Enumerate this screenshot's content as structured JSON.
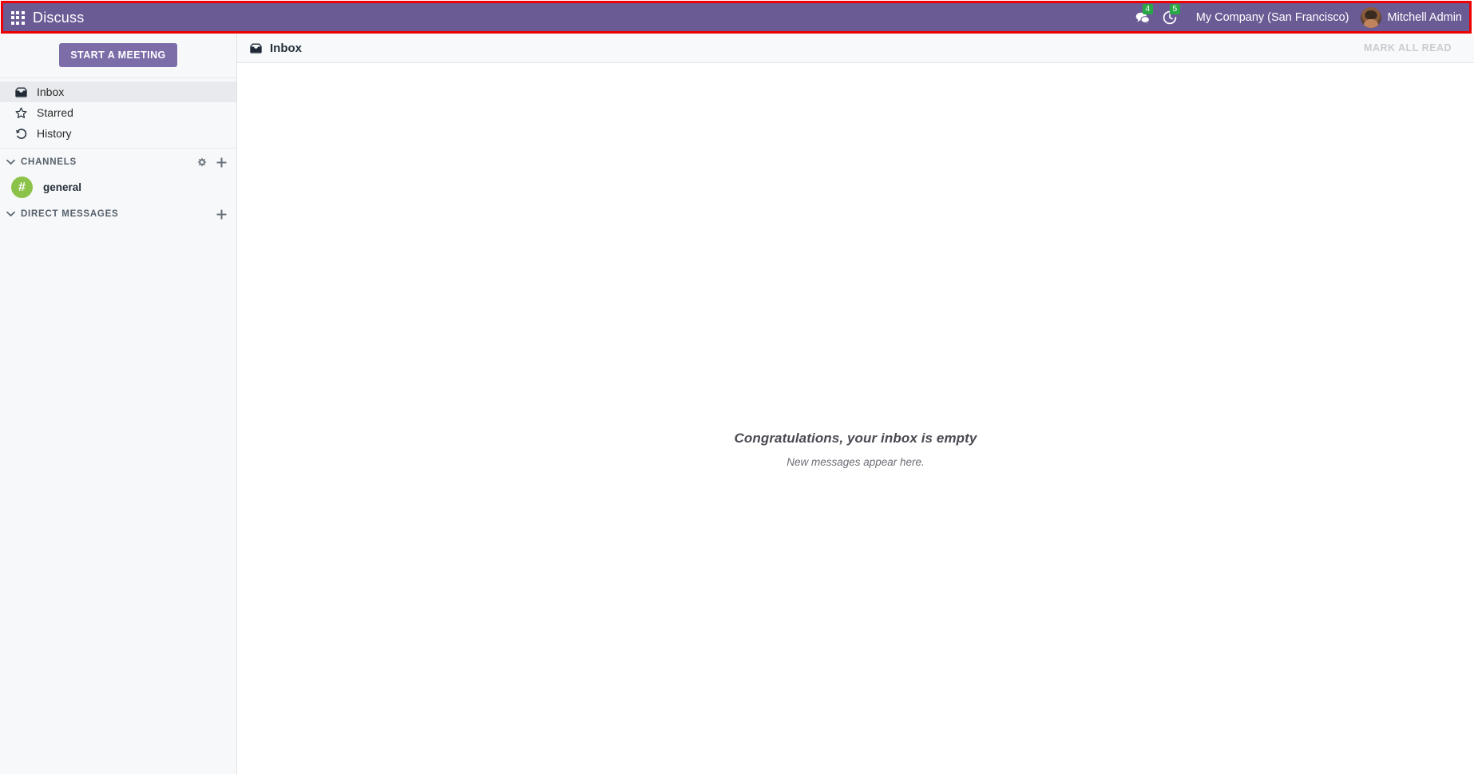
{
  "navbar": {
    "apps_icon": "apps-grid-icon",
    "brand": "Discuss",
    "messages": {
      "icon": "messages-bubble-icon",
      "badge": "4"
    },
    "activities": {
      "icon": "activity-clock-icon",
      "badge": "5"
    },
    "company": "My Company (San Francisco)",
    "user": "Mitchell Admin",
    "avatar_alt": "user-avatar",
    "background_color": "#6b5b95",
    "badge_color": "#28a745",
    "highlight_color": "#ee0000"
  },
  "sidebar": {
    "start_meeting_label": "START A MEETING",
    "mailboxes": [
      {
        "label": "Inbox",
        "icon": "inbox-icon",
        "active": true
      },
      {
        "label": "Starred",
        "icon": "star-icon",
        "active": false
      },
      {
        "label": "History",
        "icon": "history-icon",
        "active": false
      }
    ],
    "channels_section": {
      "title": "CHANNELS",
      "caret_icon": "chevron-down-icon",
      "settings_icon": "gear-icon",
      "add_icon": "plus-icon",
      "items": [
        {
          "name": "general",
          "symbol": "#",
          "color": "#8bc34a"
        }
      ]
    },
    "direct_messages_section": {
      "title": "DIRECT MESSAGES",
      "caret_icon": "chevron-down-icon",
      "add_icon": "plus-icon",
      "items": []
    }
  },
  "main": {
    "thread_icon": "inbox-icon",
    "thread_title": "Inbox",
    "mark_all_read_label": "MARK ALL READ",
    "mark_all_read_disabled": true,
    "empty_title": "Congratulations, your inbox is empty",
    "empty_subtitle": "New messages appear here."
  }
}
